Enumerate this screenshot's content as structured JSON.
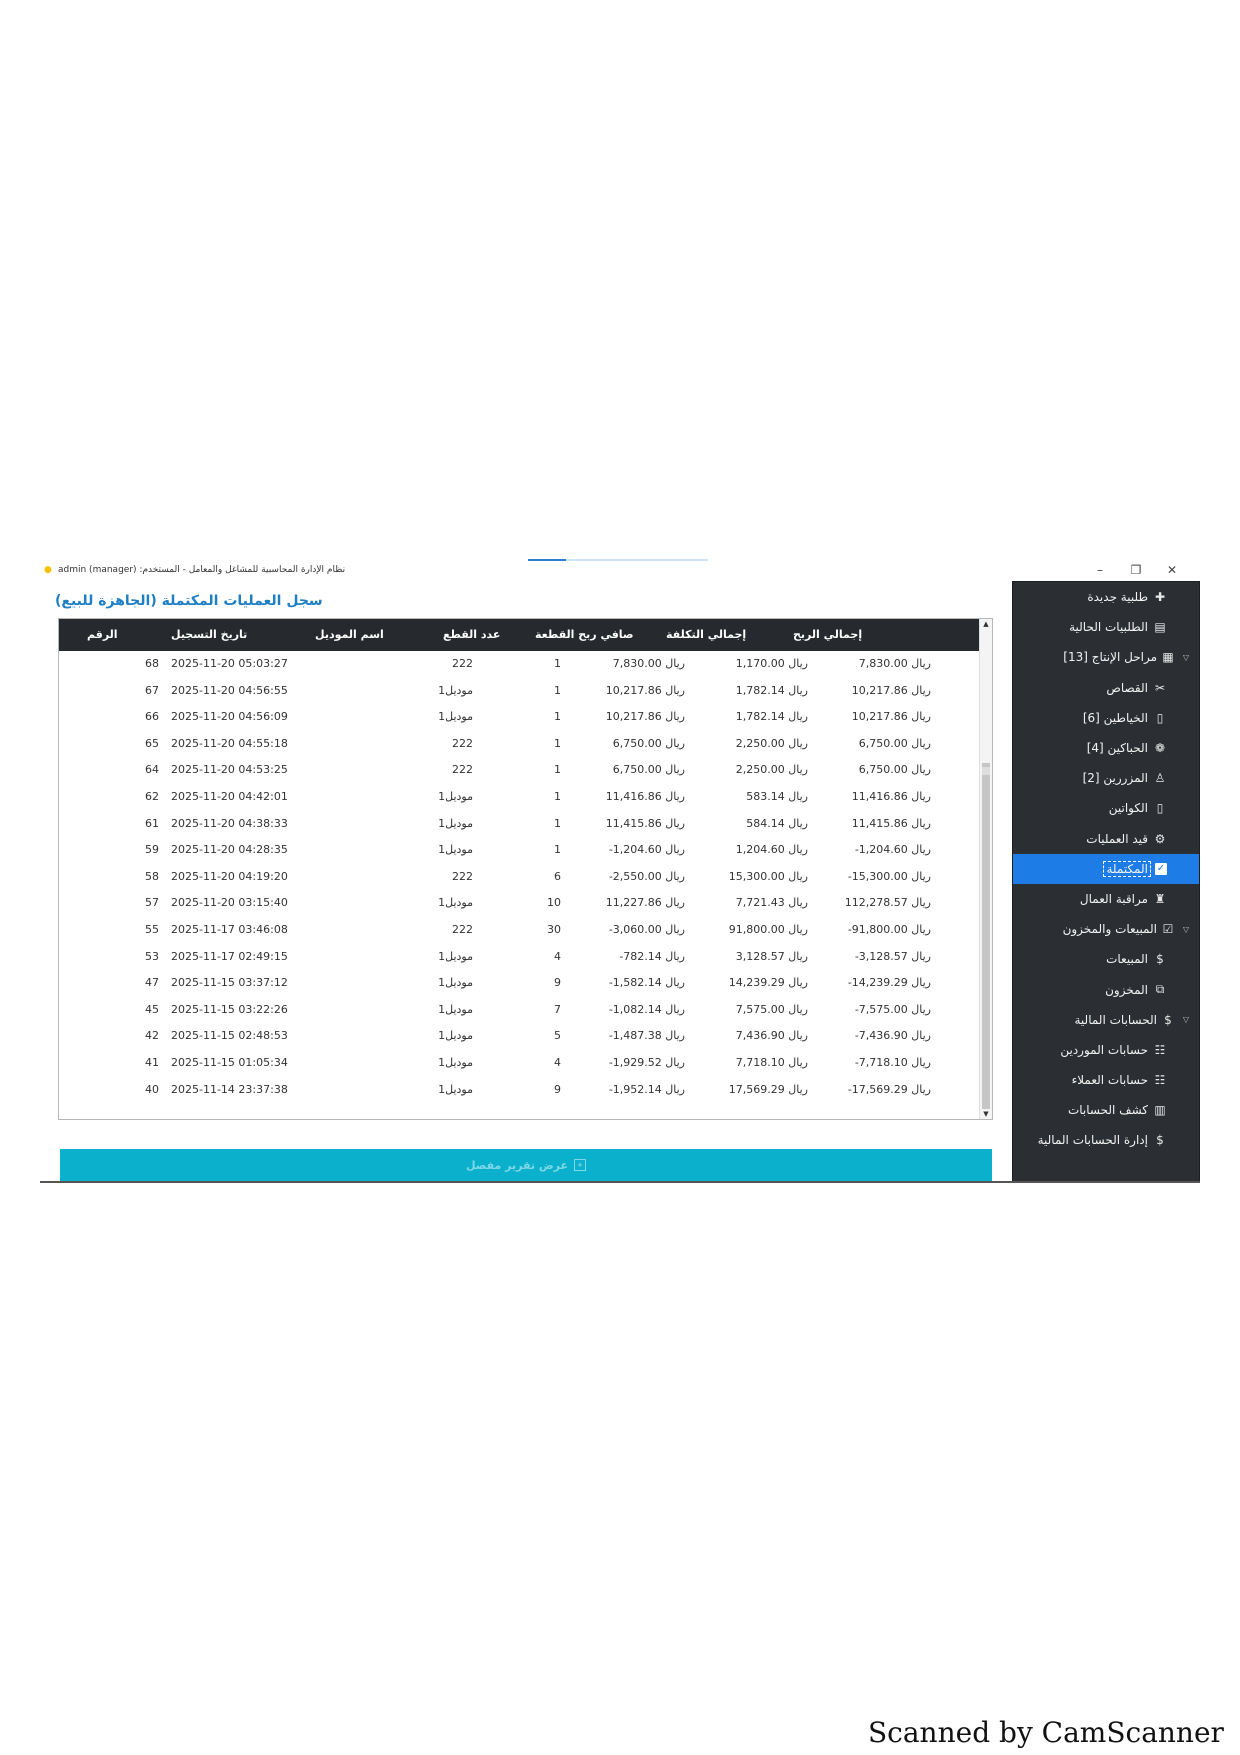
{
  "window": {
    "title": "نظام الإدارة المحاسبية للمشاغل والمعامل - المستخدم: admin (manager)",
    "controls": {
      "minimize": "–",
      "maximize": "❐",
      "close": "✕"
    }
  },
  "sidebar": {
    "items": [
      {
        "label": "طلبية جديدة",
        "icon": "plus-icon",
        "glyph": "✚",
        "kind": "level0"
      },
      {
        "label": "الطلبيات الحالية",
        "icon": "orders-icon",
        "glyph": "▤",
        "kind": "level0"
      },
      {
        "label": "مراحل الإنتاج [13]",
        "icon": "factory-icon",
        "glyph": "▦",
        "kind": "group"
      },
      {
        "label": "القصاص",
        "icon": "scissors-icon",
        "glyph": "✂",
        "kind": "level1"
      },
      {
        "label": "الخياطين [6]",
        "icon": "square-icon",
        "glyph": "▯",
        "kind": "level1"
      },
      {
        "label": "الحباكين [4]",
        "icon": "thread-icon",
        "glyph": "❁",
        "kind": "level1"
      },
      {
        "label": "المزررين [2]",
        "icon": "worker-icon",
        "glyph": "♙",
        "kind": "level1"
      },
      {
        "label": "الكواتين",
        "icon": "square-icon",
        "glyph": "▯",
        "kind": "level1"
      },
      {
        "label": "قيد العمليات",
        "icon": "gear-icon",
        "glyph": "⚙",
        "kind": "level1"
      },
      {
        "label": "المكتملة",
        "icon": "checkbox-icon",
        "glyph": "✓",
        "kind": "level1",
        "selected": true
      },
      {
        "label": "مراقبة العمال",
        "icon": "monitor-icon",
        "glyph": "♜",
        "kind": "level1"
      },
      {
        "label": "المبيعات والمخزون",
        "icon": "checklist-icon",
        "glyph": "☑",
        "kind": "group"
      },
      {
        "label": "المبيعات",
        "icon": "money-icon",
        "glyph": "$",
        "kind": "level1"
      },
      {
        "label": "المخزون",
        "icon": "box-icon",
        "glyph": "⧉",
        "kind": "level1"
      },
      {
        "label": "الحسابات المالية",
        "icon": "coin-icon",
        "glyph": "$",
        "kind": "group"
      },
      {
        "label": "حسابات الموردين",
        "icon": "suppliers-icon",
        "glyph": "☷",
        "kind": "level1"
      },
      {
        "label": "حسابات العملاء",
        "icon": "customers-icon",
        "glyph": "☷",
        "kind": "level1"
      },
      {
        "label": "كشف الحسابات",
        "icon": "bar-chart-icon",
        "glyph": "▥",
        "kind": "level1"
      },
      {
        "label": "إدارة الحسابات المالية",
        "icon": "coin-icon",
        "glyph": "$",
        "kind": "level1"
      }
    ]
  },
  "main": {
    "title": "سجل العمليات المكتملة (الجاهزة للبيع)",
    "columns": {
      "number": "الرقم",
      "date": "تاريخ التسجيل",
      "model": "اسم الموديل",
      "pieces": "عدد القطع",
      "net_profit_per_piece": "صافي ربح القطعة",
      "total_cost": "إجمالي التكلفة",
      "total_profit": "إجمالي الربح"
    },
    "rows": [
      {
        "number": "68",
        "date": "2025-11-20 05:03:27",
        "model": "222",
        "pieces": "1",
        "net_profit_per_piece": "7,830.00 ريال",
        "total_cost": "1,170.00 ريال",
        "total_profit": "7,830.00 ريال"
      },
      {
        "number": "67",
        "date": "2025-11-20 04:56:55",
        "model": "موديل1",
        "pieces": "1",
        "net_profit_per_piece": "10,217.86 ريال",
        "total_cost": "1,782.14 ريال",
        "total_profit": "10,217.86 ريال"
      },
      {
        "number": "66",
        "date": "2025-11-20 04:56:09",
        "model": "موديل1",
        "pieces": "1",
        "net_profit_per_piece": "10,217.86 ريال",
        "total_cost": "1,782.14 ريال",
        "total_profit": "10,217.86 ريال"
      },
      {
        "number": "65",
        "date": "2025-11-20 04:55:18",
        "model": "222",
        "pieces": "1",
        "net_profit_per_piece": "6,750.00 ريال",
        "total_cost": "2,250.00 ريال",
        "total_profit": "6,750.00 ريال"
      },
      {
        "number": "64",
        "date": "2025-11-20 04:53:25",
        "model": "222",
        "pieces": "1",
        "net_profit_per_piece": "6,750.00 ريال",
        "total_cost": "2,250.00 ريال",
        "total_profit": "6,750.00 ريال"
      },
      {
        "number": "62",
        "date": "2025-11-20 04:42:01",
        "model": "موديل1",
        "pieces": "1",
        "net_profit_per_piece": "11,416.86 ريال",
        "total_cost": "583.14 ريال",
        "total_profit": "11,416.86 ريال"
      },
      {
        "number": "61",
        "date": "2025-11-20 04:38:33",
        "model": "موديل1",
        "pieces": "1",
        "net_profit_per_piece": "11,415.86 ريال",
        "total_cost": "584.14 ريال",
        "total_profit": "11,415.86 ريال"
      },
      {
        "number": "59",
        "date": "2025-11-20 04:28:35",
        "model": "موديل1",
        "pieces": "1",
        "net_profit_per_piece": "-1,204.60 ريال",
        "total_cost": "1,204.60 ريال",
        "total_profit": "-1,204.60 ريال"
      },
      {
        "number": "58",
        "date": "2025-11-20 04:19:20",
        "model": "222",
        "pieces": "6",
        "net_profit_per_piece": "-2,550.00 ريال",
        "total_cost": "15,300.00 ريال",
        "total_profit": "-15,300.00 ريال"
      },
      {
        "number": "57",
        "date": "2025-11-20 03:15:40",
        "model": "موديل1",
        "pieces": "10",
        "net_profit_per_piece": "11,227.86 ريال",
        "total_cost": "7,721.43 ريال",
        "total_profit": "112,278.57 ريال"
      },
      {
        "number": "55",
        "date": "2025-11-17 03:46:08",
        "model": "222",
        "pieces": "30",
        "net_profit_per_piece": "-3,060.00 ريال",
        "total_cost": "91,800.00 ريال",
        "total_profit": "-91,800.00 ريال"
      },
      {
        "number": "53",
        "date": "2025-11-17 02:49:15",
        "model": "موديل1",
        "pieces": "4",
        "net_profit_per_piece": "-782.14 ريال",
        "total_cost": "3,128.57 ريال",
        "total_profit": "-3,128.57 ريال"
      },
      {
        "number": "47",
        "date": "2025-11-15 03:37:12",
        "model": "موديل1",
        "pieces": "9",
        "net_profit_per_piece": "-1,582.14 ريال",
        "total_cost": "14,239.29 ريال",
        "total_profit": "-14,239.29 ريال"
      },
      {
        "number": "45",
        "date": "2025-11-15 03:22:26",
        "model": "موديل1",
        "pieces": "7",
        "net_profit_per_piece": "-1,082.14 ريال",
        "total_cost": "7,575.00 ريال",
        "total_profit": "-7,575.00 ريال"
      },
      {
        "number": "42",
        "date": "2025-11-15 02:48:53",
        "model": "موديل1",
        "pieces": "5",
        "net_profit_per_piece": "-1,487.38 ريال",
        "total_cost": "7,436.90 ريال",
        "total_profit": "-7,436.90 ريال"
      },
      {
        "number": "41",
        "date": "2025-11-15 01:05:34",
        "model": "موديل1",
        "pieces": "4",
        "net_profit_per_piece": "-1,929.52 ريال",
        "total_cost": "7,718.10 ريال",
        "total_profit": "-7,718.10 ريال"
      },
      {
        "number": "40",
        "date": "2025-11-14 23:37:38",
        "model": "موديل1",
        "pieces": "9",
        "net_profit_per_piece": "-1,952.14 ريال",
        "total_cost": "17,569.29 ريال",
        "total_profit": "-17,569.29 ريال"
      }
    ],
    "report_button": "عرض تقرير مفصل"
  },
  "footer": {
    "scanner_text": "Scanned by CamScanner"
  },
  "colors": {
    "sidebar_bg": "#2b2e33",
    "selected_bg": "#1e7ce6",
    "header_bg": "#262a2f",
    "title_accent": "#1f7fc4",
    "button_bg": "#0ab0cc"
  }
}
